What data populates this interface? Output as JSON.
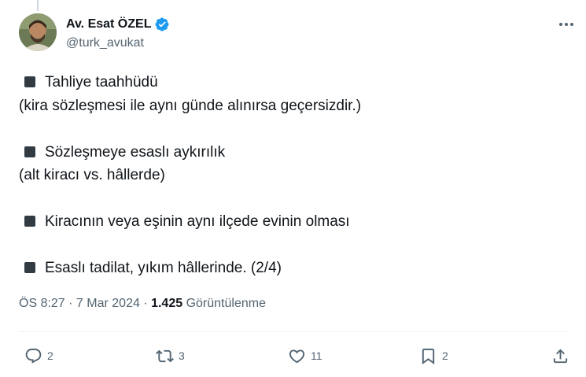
{
  "author": {
    "display_name": "Av. Esat ÖZEL",
    "handle": "@turk_avukat",
    "verified_icon": "verified-badge-icon",
    "avatar_icon": "profile-photo"
  },
  "menu_icon": "more-horizontal-icon",
  "tweet": {
    "items": [
      {
        "title": "Tahliye taahhüdü",
        "note": "(kira sözleşmesi ile aynı günde alınırsa geçersizdir.)"
      },
      {
        "title": "Sözleşmeye esaslı aykırılık",
        "note": "(alt kiracı vs. hâllerde)"
      },
      {
        "title": "Kiracının veya eşinin aynı ilçede evinin olması"
      },
      {
        "title": "Esaslı tadilat, yıkım hâllerinde. (2/4)"
      }
    ]
  },
  "meta": {
    "time": "ÖS 8:27",
    "separator": " · ",
    "date": "7 Mar 2024",
    "views_count": "1.425",
    "views_label": "Görüntülenme"
  },
  "actions": {
    "replies": "2",
    "reposts": "3",
    "likes": "11",
    "bookmarks": "2"
  },
  "colors": {
    "text": "#0f1419",
    "secondary": "#536471",
    "verified": "#1d9bf0",
    "bullet_square": "#333b42"
  }
}
